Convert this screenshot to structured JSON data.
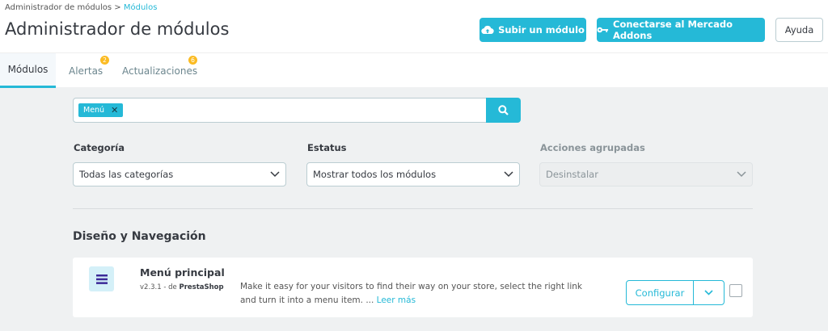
{
  "breadcrumb": {
    "parent": "Administrador de módulos",
    "sep": ">",
    "current": "Módulos"
  },
  "header": {
    "title": "Administrador de módulos",
    "upload": "Subir un módulo",
    "connect": "Conectarse al Mercado Addons",
    "help": "Ayuda"
  },
  "tabs": [
    {
      "label": "Módulos"
    },
    {
      "label": "Alertas",
      "badge": "2"
    },
    {
      "label": "Actualizaciones",
      "badge": "6"
    }
  ],
  "search": {
    "tag": "Menú"
  },
  "filters": {
    "category_label": "Categoría",
    "category_value": "Todas las categorías",
    "status_label": "Estatus",
    "status_value": "Mostrar todos los módulos",
    "bulk_label": "Acciones agrupadas",
    "bulk_value": "Desinstalar"
  },
  "section": {
    "title": "Diseño y Navegación"
  },
  "module": {
    "name": "Menú principal",
    "version": "v2.3.1 - de ",
    "author": "PrestaShop",
    "description": "Make it easy for your visitors to find their way on your store, select the right link and turn it into a menu item. ... ",
    "read_more": "Leer más",
    "configure": "Configurar"
  },
  "colors": {
    "accent": "#25b9d7",
    "badge": "#fbbb22"
  }
}
